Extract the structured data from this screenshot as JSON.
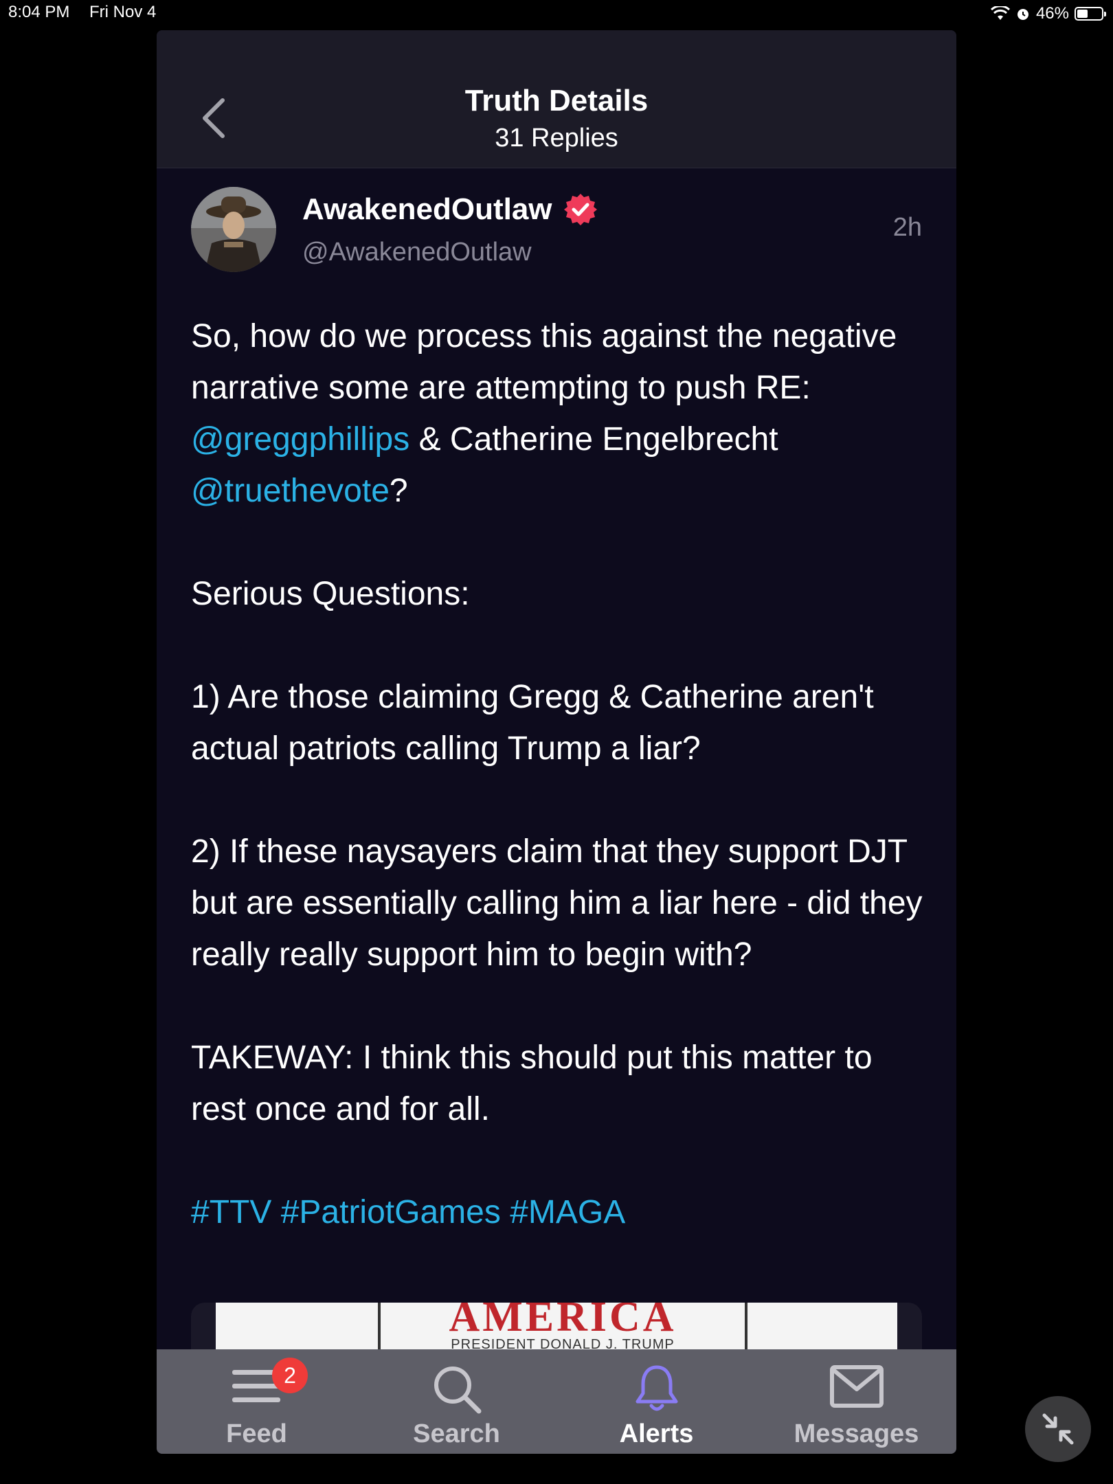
{
  "status_bar": {
    "time": "8:04 PM",
    "date": "Fri Nov 4",
    "battery": "46%"
  },
  "header": {
    "title": "Truth Details",
    "subtitle": "31 Replies"
  },
  "post": {
    "display_name": "AwakenedOutlaw",
    "handle": "@AwakenedOutlaw",
    "timestamp": "2h",
    "body": {
      "p1_text1": "So, how do we process this against the negative narrative some are attempting to push RE: ",
      "p1_mention1": "@greggphillips",
      "p1_text2": " & Catherine Engelbrecht ",
      "p1_mention2": "@truethevote",
      "p1_text3": "?",
      "p2": "Serious Questions:",
      "p3": "1) Are those claiming Gregg & Catherine aren't actual patriots calling Trump a liar?",
      "p4": "2) If these naysayers claim that they support DJT but are essentially calling him a liar here - did they really really support him to begin with?",
      "p5": "TAKEWAY: I think this should put this matter to rest once and for all.",
      "hashtags": [
        "#TTV",
        "#PatriotGames",
        "#MAGA"
      ]
    },
    "media": {
      "headline": "AMERICA",
      "caption": "PRESIDENT DONALD J. TRUMP"
    }
  },
  "tabs": [
    {
      "label": "Feed",
      "badge": "2",
      "icon": "feed-icon"
    },
    {
      "label": "Search",
      "icon": "search-icon"
    },
    {
      "label": "Alerts",
      "icon": "bell-icon",
      "active": true
    },
    {
      "label": "Messages",
      "icon": "envelope-icon"
    }
  ],
  "colors": {
    "accent": "#2bb2e6",
    "verified": "#ef3b5a",
    "alerts_active": "#8a7cf4",
    "badge": "#ef3b39"
  }
}
